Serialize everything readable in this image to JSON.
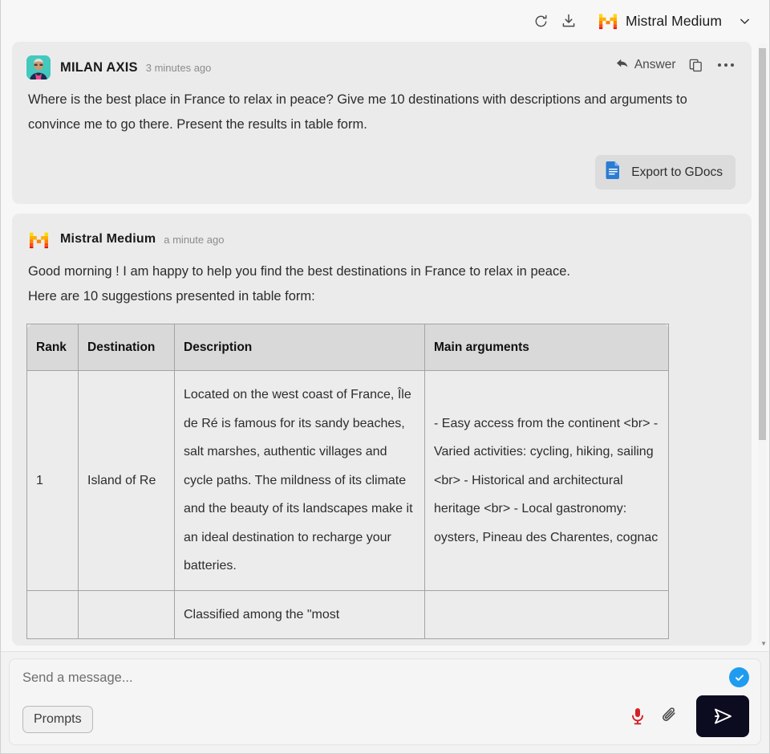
{
  "topbar": {
    "refresh_icon": "refresh-icon",
    "download_icon": "download-icon",
    "model_name": "Mistral Medium",
    "chevron_icon": "chevron-down-icon"
  },
  "conversation": [
    {
      "role": "user",
      "author": "MILAN AXIS",
      "time": "3 minutes ago",
      "actions": {
        "answer_label": "Answer",
        "answer_icon": "reply-arrow-icon",
        "copy_icon": "copy-icon",
        "more_icon": "more-options-icon"
      },
      "text": "Where is the best place in France to relax in peace? Give me 10 destinations with descriptions and arguments to convince me to go there. Present the results in table form.",
      "export_button": {
        "label": "Export to GDocs",
        "icon": "google-docs-icon"
      }
    },
    {
      "role": "assistant",
      "author": "Mistral Medium",
      "time": "a minute ago",
      "logo_icon": "mistral-logo-icon",
      "intro_line_1": "Good morning ! I am happy to help you find the best destinations in France to relax in peace.",
      "intro_line_2": "Here are 10 suggestions presented in table form:"
    }
  ],
  "table": {
    "headers": [
      "Rank",
      "Destination",
      "Description",
      "Main arguments"
    ],
    "rows": [
      {
        "rank": "1",
        "destination": "Island of Re",
        "description": "Located on the west coast of France, Île de Ré is famous for its sandy beaches, salt marshes, authentic villages and cycle paths. The mildness of its climate and the beauty of its landscapes make it an ideal destination to recharge your batteries.",
        "arguments": "- Easy access from the continent <br> - Varied activities: cycling, hiking, sailing <br> - Historical and architectural heritage <br> - Local gastronomy: oysters, Pineau des Charentes, cognac"
      },
      {
        "rank": "",
        "destination": "",
        "description": "Classified among the \"most",
        "arguments": ""
      }
    ]
  },
  "composer": {
    "placeholder": "Send a message...",
    "value": "",
    "prompts_label": "Prompts",
    "status_icon": "check-circle-icon",
    "mic_icon": "microphone-icon",
    "attach_icon": "paperclip-icon",
    "send_icon": "send-icon"
  },
  "colors": {
    "accent_blue": "#1f9cf0",
    "send_button": "#0c0c20",
    "card_bg": "#ebebeb",
    "page_bg": "#f7f7f7",
    "mic_red": "#d61f26",
    "gdocs_blue": "#2b7cd3"
  }
}
